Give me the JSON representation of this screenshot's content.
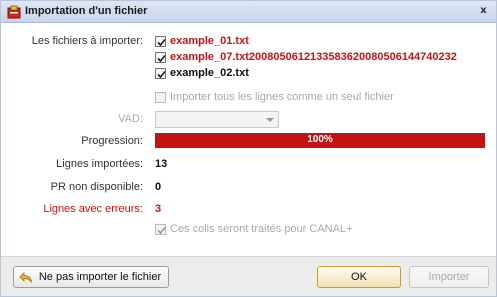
{
  "window": {
    "title": "Importation d'un fichier",
    "close_glyph": "x"
  },
  "files_section": {
    "label": "Les fichiers à importer:",
    "files": [
      {
        "name": "example_01.txt",
        "checked": true,
        "color": "#cc1111"
      },
      {
        "name": "example_07.txt20080506121335836200805061447402​32",
        "checked": true,
        "color": "#cc1111"
      },
      {
        "name": "example_02.txt",
        "checked": true,
        "color": "#111111"
      }
    ]
  },
  "import_all_option": {
    "label": "Importer tous les lignes comme un seul fichier",
    "checked": false,
    "enabled": false
  },
  "vad": {
    "label": "VAD:",
    "value": "",
    "enabled": false
  },
  "progress": {
    "label": "Progression:",
    "percent": 100,
    "text": "100%",
    "color": "#c41212"
  },
  "stats": {
    "imported_label": "Lignes importées:",
    "imported_value": "13",
    "pr_label": "PR non disponible:",
    "pr_value": "0",
    "errors_label": "Lignes avec erreurs:",
    "errors_value": "3"
  },
  "canal_option": {
    "label": "Ces colis seront traités pour CANAL+",
    "checked": true,
    "enabled": false
  },
  "buttons": {
    "dont_import": "Ne pas importer le fichier",
    "ok": "OK",
    "import": "Importer"
  }
}
